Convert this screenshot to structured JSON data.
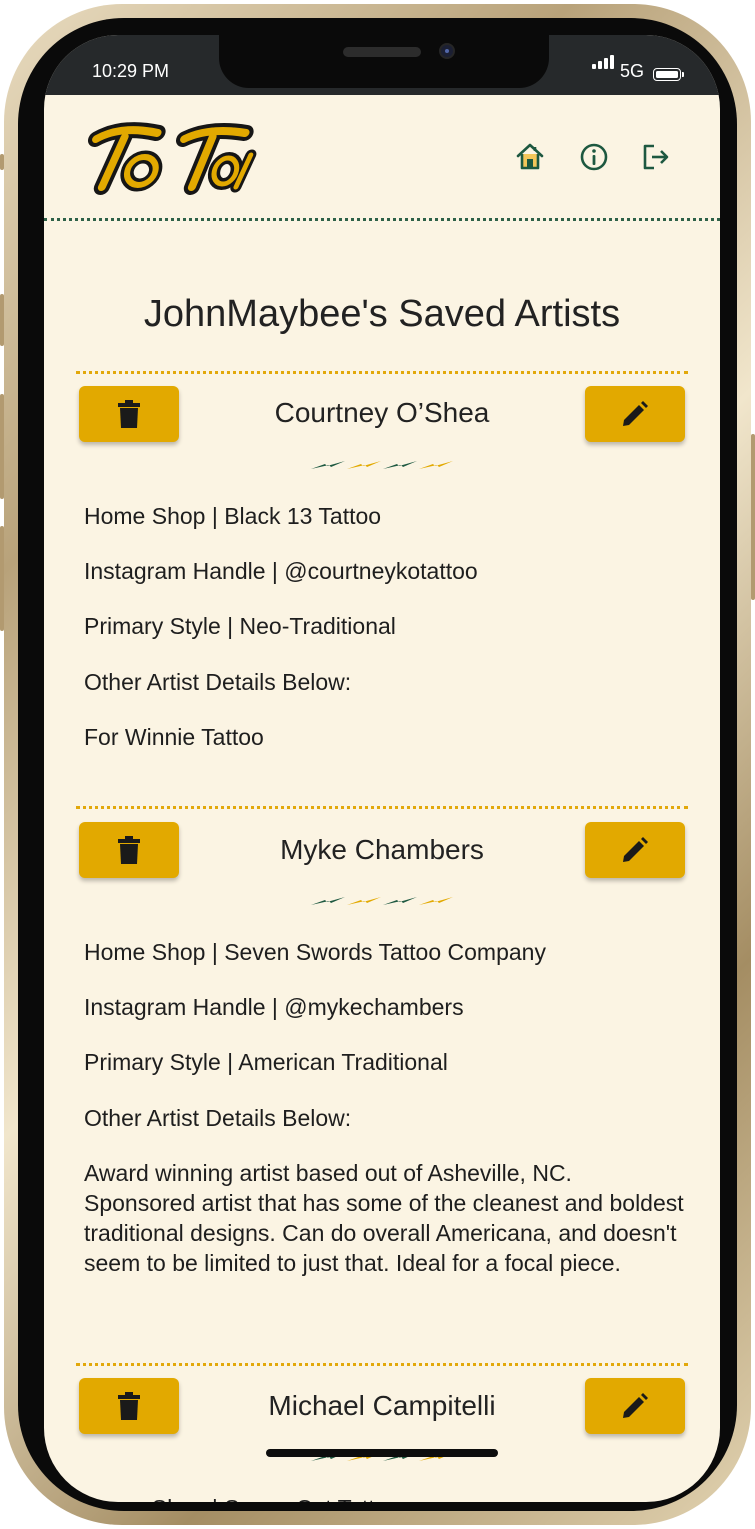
{
  "status_bar": {
    "time": "10:29 PM",
    "network": "5G"
  },
  "app": {
    "logo_text": "To Tat",
    "nav": [
      {
        "name": "home",
        "icon": "home-icon"
      },
      {
        "name": "info",
        "icon": "info-icon"
      },
      {
        "name": "logout",
        "icon": "logout-icon"
      }
    ]
  },
  "page": {
    "title": "JohnMaybee's Saved Artists"
  },
  "artists": [
    {
      "name": "Courtney O’Shea",
      "home_shop": "Home Shop | Black 13 Tattoo",
      "instagram": "Instagram Handle | @courtneykotattoo",
      "style": "Primary Style | Neo-Traditional",
      "details_label": "Other Artist Details Below:",
      "details": "For Winnie Tattoo"
    },
    {
      "name": "Myke Chambers",
      "home_shop": "Home Shop | Seven Swords Tattoo Company",
      "instagram": "Instagram Handle | @mykechambers",
      "style": "Primary Style | American Traditional",
      "details_label": "Other Artist Details Below:",
      "details": "Award winning artist based out of Asheville, NC. Sponsored artist that has some of the cleanest and boldest traditional designs. Can do overall Americana, and doesn't seem to be limited to just that. Ideal for a focal piece."
    },
    {
      "name": "Michael Campitelli",
      "home_shop": "Home Shop | Seven Cut Tattoo"
    }
  ],
  "colors": {
    "accent": "#e2a900",
    "brand_green": "#1d5840",
    "background": "#fbf4e3",
    "divider": "#e2a80a"
  }
}
